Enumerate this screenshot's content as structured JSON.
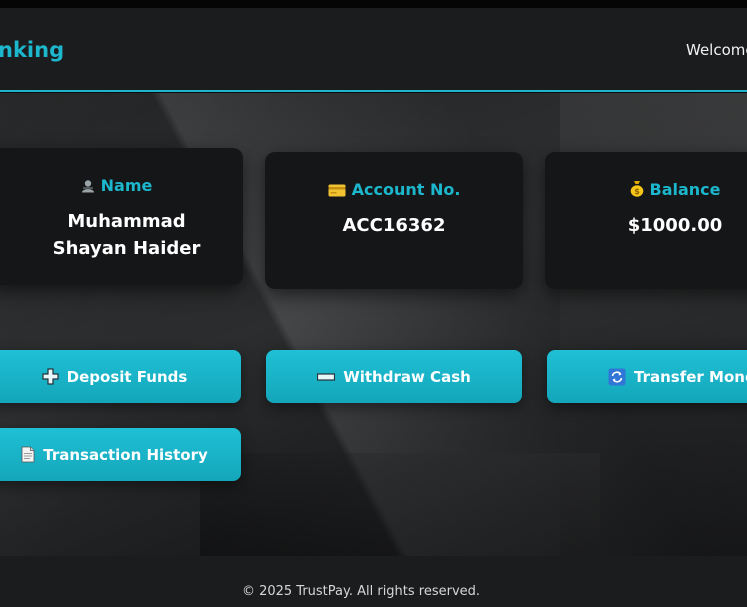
{
  "header": {
    "brand": "nking",
    "welcome": "Welcome"
  },
  "cards": {
    "name": {
      "label": "Name",
      "value": "Muhammad Shayan Haider",
      "icon": "user-icon"
    },
    "account": {
      "label": "Account No.",
      "value": "ACC16362",
      "icon": "credit-card-icon"
    },
    "balance": {
      "label": "Balance",
      "value": "$1000.00",
      "icon": "money-bag-icon"
    }
  },
  "actions": {
    "deposit": "Deposit Funds",
    "withdraw": "Withdraw Cash",
    "transfer": "Transfer Money",
    "history": "Transaction History"
  },
  "footer": {
    "copyright": "© 2025 TrustPay. All rights reserved."
  },
  "colors": {
    "accent": "#1cb7cc",
    "card_bg": "#151618",
    "header_bg": "#1b1c1e"
  }
}
